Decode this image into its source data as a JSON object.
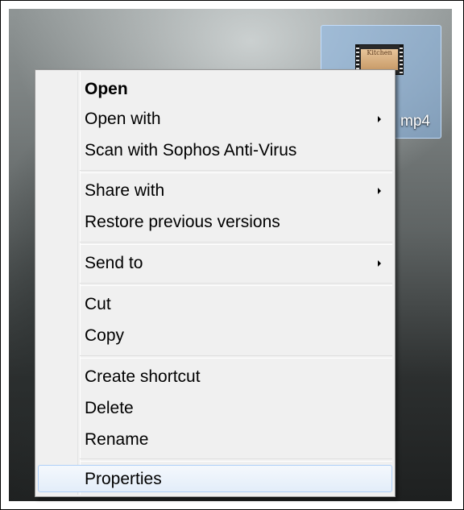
{
  "desktop": {
    "file": {
      "label": "mp4",
      "thumbnail_text": "Kitchen"
    }
  },
  "context_menu": {
    "items": [
      {
        "label": "Open",
        "bold": true
      },
      {
        "label": "Open with",
        "submenu": true
      },
      {
        "label": "Scan with Sophos Anti-Virus"
      },
      {
        "label": "Share with",
        "submenu": true
      },
      {
        "label": "Restore previous versions"
      },
      {
        "label": "Send to",
        "submenu": true
      },
      {
        "label": "Cut"
      },
      {
        "label": "Copy"
      },
      {
        "label": "Create shortcut"
      },
      {
        "label": "Delete"
      },
      {
        "label": "Rename"
      },
      {
        "label": "Properties",
        "highlighted": true
      }
    ]
  }
}
